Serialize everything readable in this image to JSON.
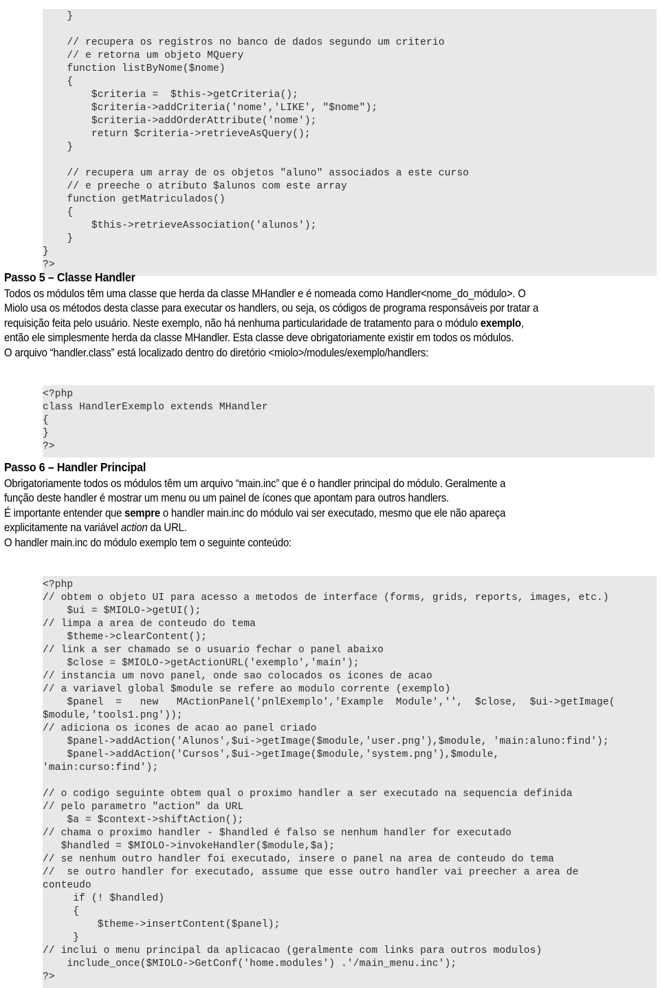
{
  "document": {
    "language": "pt-BR",
    "type": "technical-manual-page"
  },
  "code_block_1": {
    "name": "curso-class-php-snippet",
    "lines": [
      "    }",
      "",
      "    // recupera os registros no banco de dados segundo um criterio",
      "    // e retorna um objeto MQuery",
      "    function listByNome($nome)",
      "    {",
      "        $criteria =  $this->getCriteria();",
      "        $criteria->addCriteria('nome','LIKE', \"$nome\");",
      "        $criteria->addOrderAttribute('nome');",
      "        return $criteria->retrieveAsQuery();",
      "    }",
      "",
      "    // recupera um array de os objetos \"aluno\" associados a este curso",
      "    // e preeche o atributo $alunos com este array",
      "    function getMatriculados()",
      "    {",
      "        $this->retrieveAssociation('alunos');",
      "    }",
      "}",
      "?>"
    ]
  },
  "section_passo5": {
    "heading": "Passo 5 – Classe Handler",
    "paragraph_lines": [
      "Todos os módulos têm uma classe que herda da classe MHandler e é nomeada como Handler<nome_do_módulo>. O",
      "Miolo usa os métodos desta classe para executar os handlers, ou seja, os códigos de programa responsáveis por tratar a",
      "requisição feita pelo usuário. Neste exemplo, não há nenhuma particularidade de tratamento para o módulo exemplo,",
      "então ele simplesmente herda da classe MHandler. Esta classe deve obrigatoriamente existir em todos os módulos.",
      "O arquivo “handler.class” está localizado dentro do diretório <miolo>/modules/exemplo/handlers:"
    ],
    "bold_terms": [
      "exemplo"
    ]
  },
  "code_block_2": {
    "name": "handler-class-php-snippet",
    "lines": [
      "<?php",
      "class HandlerExemplo extends MHandler",
      "{",
      "}",
      "?>"
    ]
  },
  "section_passo6": {
    "heading": "Passo 6 – Handler Principal",
    "paragraph_lines": [
      "Obrigatoriamente todos os módulos têm um arquivo “main.inc” que é o handler principal do módulo. Geralmente a",
      "função deste handler é mostrar um menu ou um painel de ícones que apontam para outros handlers.",
      "É importante entender que sempre o handler main.inc do módulo vai ser executado, mesmo que ele não apareça",
      "explicitamente na variável action da URL.",
      "O handler main.inc do módulo exemplo tem o seguinte conteúdo:"
    ],
    "bold_terms": [
      "sempre"
    ],
    "italic_terms": [
      "action"
    ]
  },
  "code_block_3": {
    "name": "main-inc-php-snippet",
    "lines": [
      "<?php",
      "// obtem o objeto UI para acesso a metodos de interface (forms, grids, reports, images, etc.)",
      "    $ui = $MIOLO->getUI();",
      "// limpa a area de conteudo do tema",
      "    $theme->clearContent();",
      "// link a ser chamado se o usuario fechar o panel abaixo",
      "    $close = $MIOLO->getActionURL('exemplo','main');",
      "// instancia um novo panel, onde sao colocados os icones de acao",
      "// a variavel global $module se refere ao modulo corrente (exemplo)",
      "    $panel  =   new   MActionPanel('pnlExemplo','Example  Module','',  $close,  $ui->getImage(",
      "$module,'tools1.png'));",
      "// adiciona os icones de acao ao panel criado",
      "    $panel->addAction('Alunos',$ui->getImage($module,'user.png'),$module, 'main:aluno:find');",
      "    $panel->addAction('Cursos',$ui->getImage($module,'system.png'),$module,",
      "'main:curso:find');",
      "",
      "// o codigo seguinte obtem qual o proximo handler a ser executado na sequencia definida",
      "// pelo parametro \"action\" da URL",
      "    $a = $context->shiftAction();",
      "// chama o proximo handler - $handled é falso se nenhum handler for executado",
      "   $handled = $MIOLO->invokeHandler($module,$a);",
      "// se nenhum outro handler foi executado, insere o panel na area de conteudo do tema",
      "//  se outro handler for executado, assume que esse outro handler vai preecher a area de",
      "conteudo",
      "     if (! $handled)",
      "     {",
      "         $theme->insertContent($panel);",
      "     }",
      "// inclui o menu principal da aplicacao (geralmente com links para outros modulos)",
      "    include_once($MIOLO->GetConf('home.modules') .'/main_menu.inc');",
      "?>"
    ]
  },
  "colors": {
    "page_background": "#ffffff",
    "code_background": "#e8e8e8",
    "code_text": "#2b2b2b",
    "body_text": "#000000"
  }
}
